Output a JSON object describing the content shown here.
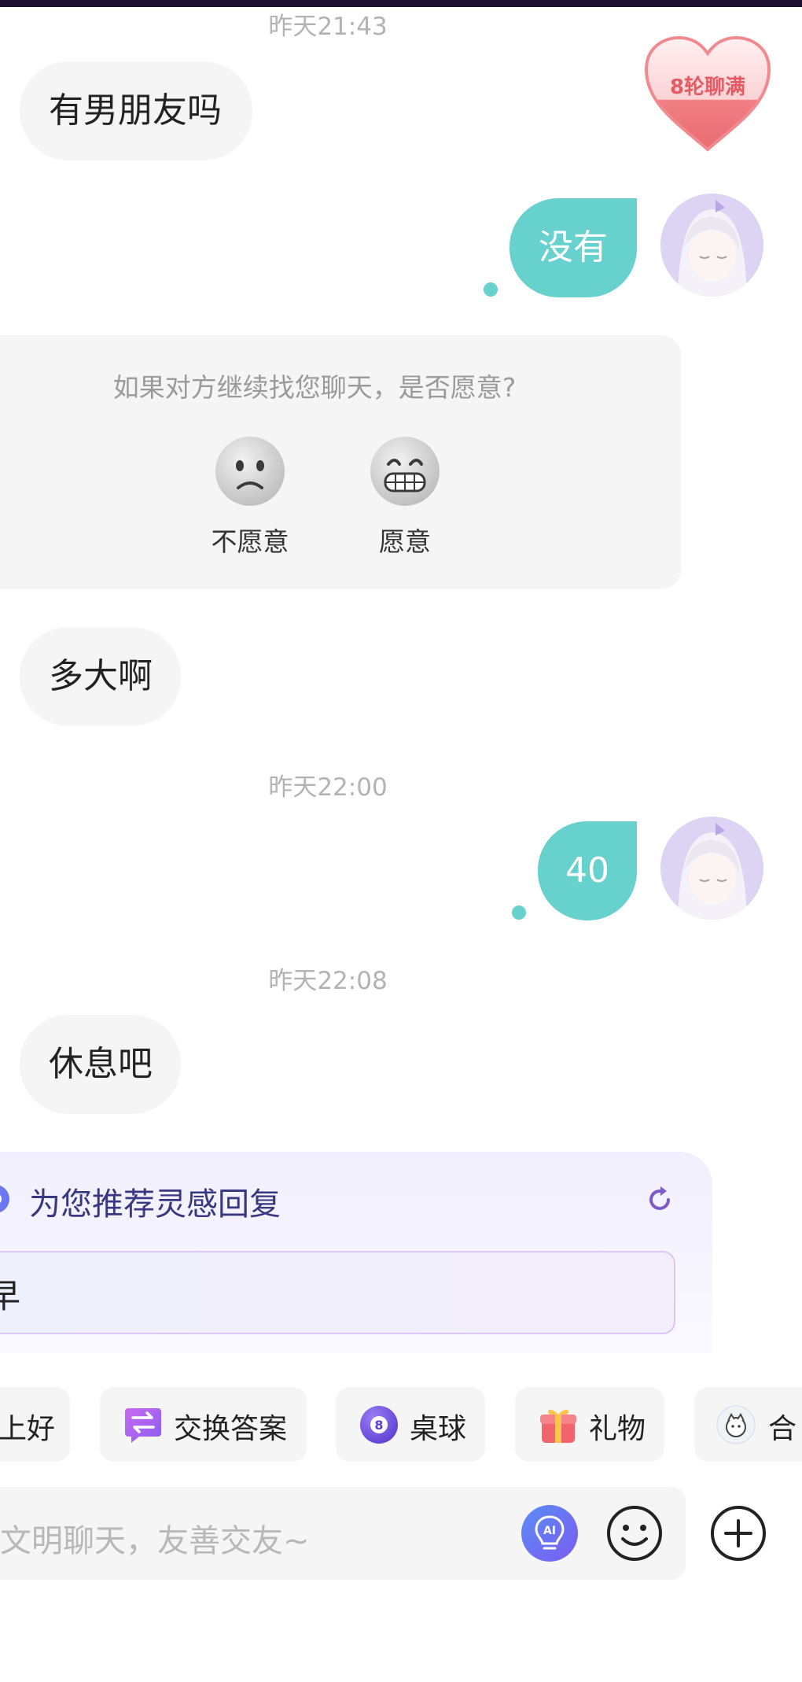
{
  "colors": {
    "accent": "#67d1ce",
    "incoming_bubble": "#f5f5f5",
    "badge": "#f08a8e",
    "inspo_title": "#3a3780",
    "topbar": "#1c1030"
  },
  "badge": {
    "label": "8轮聊满",
    "icon": "heart-icon"
  },
  "messages": {
    "t1": "昨天21:43",
    "m1": "有男朋友吗",
    "m2": "没有",
    "m3": "多大啊",
    "t2": "昨天22:00",
    "m4": "40",
    "t3": "昨天22:08",
    "m5": "休息吧"
  },
  "survey": {
    "question": "如果对方继续找您聊天，是否愿意?",
    "option_no": "不愿意",
    "option_yes": "愿意"
  },
  "inspiration": {
    "title": "为您推荐灵感回复",
    "suggestion": "早"
  },
  "chips": [
    {
      "label": "上好"
    },
    {
      "label": "交换答案",
      "icon": "swap-icon"
    },
    {
      "label": "桌球",
      "icon": "billiard-ball-icon"
    },
    {
      "label": "礼物",
      "icon": "gift-icon"
    },
    {
      "label": "合",
      "icon": "avatar-icon"
    }
  ],
  "input": {
    "placeholder": "文明聊天，友善交友~"
  },
  "icons": [
    "ai-lightbulb-icon",
    "emoji-icon",
    "plus-icon",
    "refresh-icon"
  ]
}
